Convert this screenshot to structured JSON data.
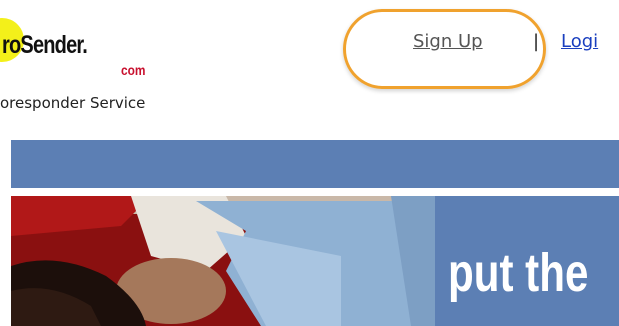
{
  "header": {
    "logo_text": "roSender.",
    "logo_dotcom": "com",
    "tagline": "oresponder Service",
    "signup_label": "Sign Up",
    "separator": "|",
    "login_label": "Logi"
  },
  "hero": {
    "headline": "put the"
  },
  "colors": {
    "nav_bar": "#5c7fb4",
    "highlight_ring": "#f0a22e",
    "login_link": "#1a3fbf",
    "logo_yellow": "#f3f01a",
    "logo_dotcom": "#c8102e"
  }
}
